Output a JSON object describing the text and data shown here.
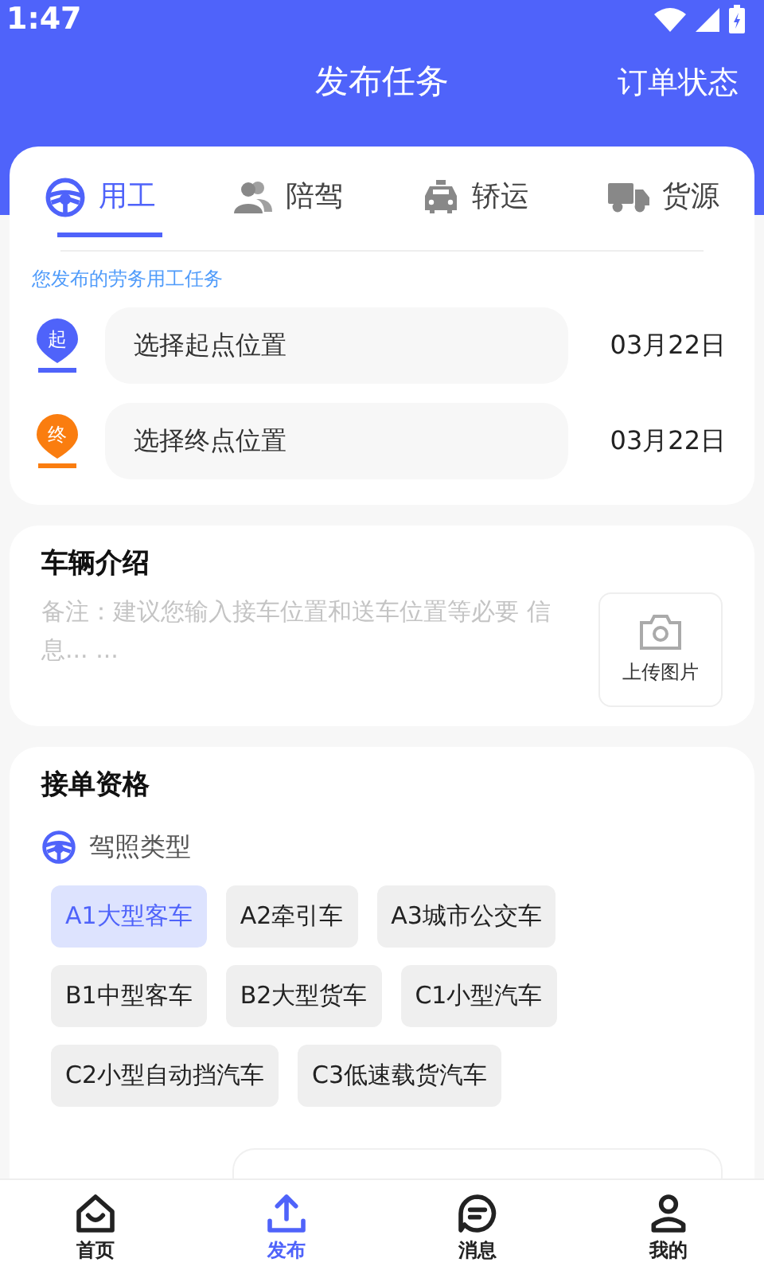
{
  "status_bar": {
    "time": "1:47"
  },
  "header": {
    "title": "发布任务",
    "action": "订单状态"
  },
  "tabs": [
    {
      "label": "用工",
      "selected": true
    },
    {
      "label": "陪驾",
      "selected": false
    },
    {
      "label": "轿运",
      "selected": false
    },
    {
      "label": "货源",
      "selected": false
    }
  ],
  "task_hint": "您发布的劳务用工任务",
  "locations": [
    {
      "marker": "起",
      "color": "#4f63fa",
      "placeholder": "选择起点位置",
      "date": "03月22日"
    },
    {
      "marker": "终",
      "color": "#fa7d0f",
      "placeholder": "选择终点位置",
      "date": "03月22日"
    }
  ],
  "vehicle": {
    "title": "车辆介绍",
    "placeholder": "备注：建议您输入接车位置和送车位置等必要 信息... ...",
    "upload_label": "上传图片"
  },
  "qualification": {
    "title": "接单资格",
    "license_label": "驾照类型",
    "licenses": [
      {
        "label": "A1大型客车",
        "selected": true
      },
      {
        "label": "A2牵引车",
        "selected": false
      },
      {
        "label": "A3城市公交车",
        "selected": false
      },
      {
        "label": "B1中型客车",
        "selected": false
      },
      {
        "label": "B2大型货车",
        "selected": false
      },
      {
        "label": "C1小型汽车",
        "selected": false
      },
      {
        "label": "C2小型自动挡汽车",
        "selected": false
      },
      {
        "label": "C3低速载货汽车",
        "selected": false
      }
    ]
  },
  "bottom_nav": [
    {
      "label": "首页",
      "selected": false
    },
    {
      "label": "发布",
      "selected": true
    },
    {
      "label": "消息",
      "selected": false
    },
    {
      "label": "我的",
      "selected": false
    }
  ]
}
